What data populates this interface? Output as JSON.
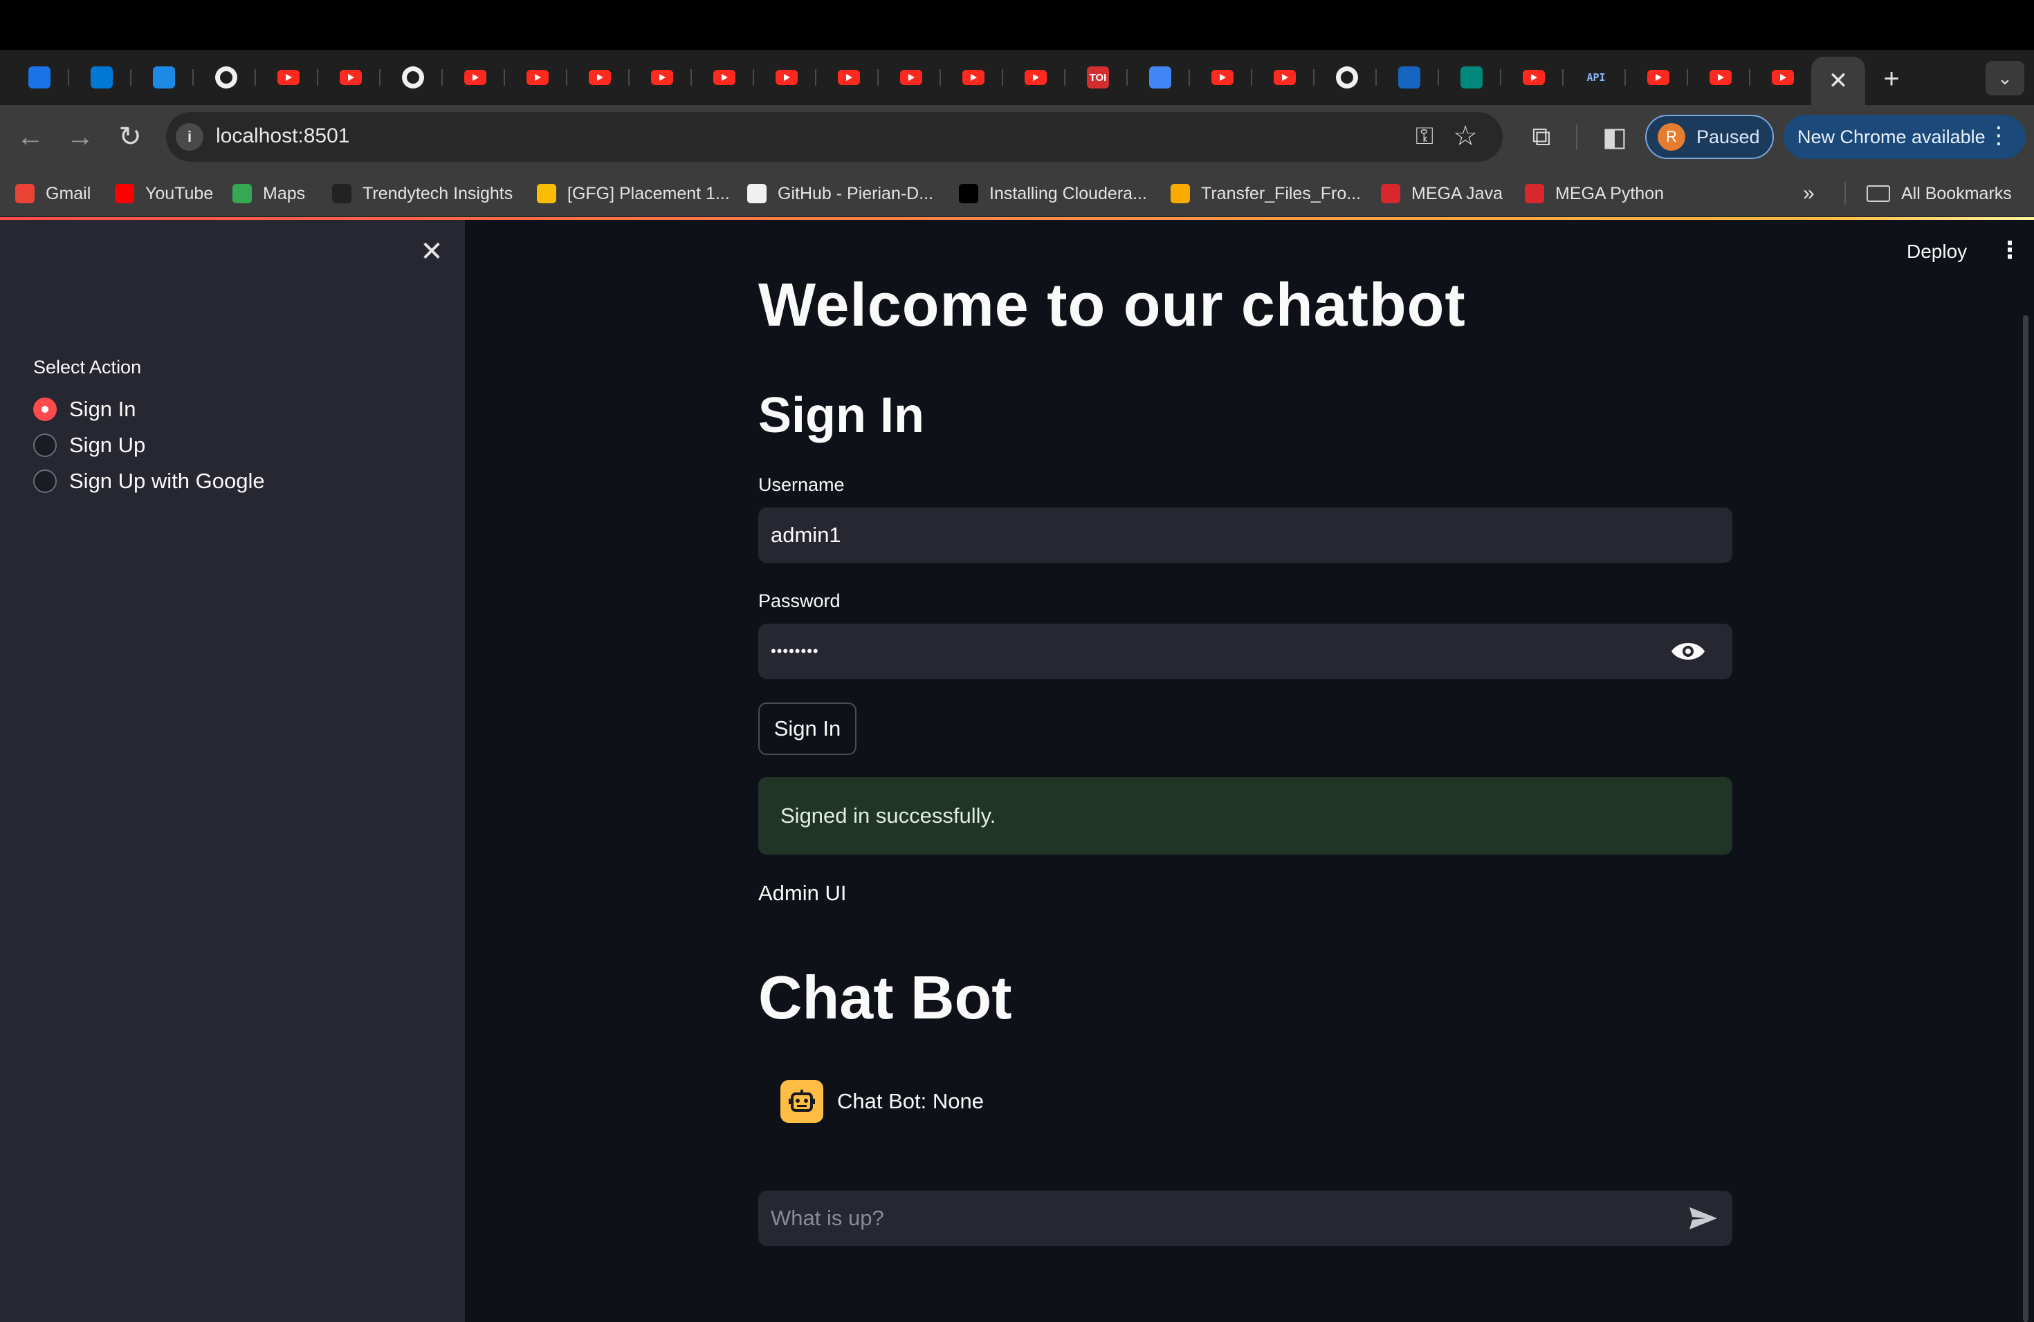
{
  "browser": {
    "tabs": [
      {
        "icon": "bar-chart-icon"
      },
      {
        "icon": "azure-devops-icon"
      },
      {
        "icon": "azure-icon"
      },
      {
        "icon": "github-icon"
      },
      {
        "icon": "youtube-icon"
      },
      {
        "icon": "youtube-icon"
      },
      {
        "icon": "github-icon"
      },
      {
        "icon": "youtube-icon"
      },
      {
        "icon": "youtube-icon"
      },
      {
        "icon": "youtube-icon"
      },
      {
        "icon": "youtube-icon"
      },
      {
        "icon": "youtube-icon"
      },
      {
        "icon": "youtube-icon"
      },
      {
        "icon": "youtube-icon"
      },
      {
        "icon": "youtube-icon"
      },
      {
        "icon": "youtube-icon"
      },
      {
        "icon": "youtube-icon"
      },
      {
        "icon": "toi-icon",
        "text": "TOI"
      },
      {
        "icon": "google-docs-icon"
      },
      {
        "icon": "youtube-icon"
      },
      {
        "icon": "youtube-icon"
      },
      {
        "icon": "github-icon"
      },
      {
        "icon": "chart-favicon-icon"
      },
      {
        "icon": "google-meet-icon"
      },
      {
        "icon": "youtube-icon"
      },
      {
        "icon": "api-icon",
        "text": "API"
      },
      {
        "icon": "youtube-icon"
      },
      {
        "icon": "youtube-icon"
      },
      {
        "icon": "youtube-icon"
      }
    ],
    "active_tab_close": "✕",
    "new_tab": "+",
    "url": "localhost:8501",
    "profile_initial": "R",
    "profile_status": "Paused",
    "update_label": "New Chrome available",
    "bookmarks": [
      {
        "label": "Gmail",
        "icon": "gmail-icon",
        "color": "#ea4335"
      },
      {
        "label": "YouTube",
        "icon": "youtube-icon",
        "color": "#ff0000"
      },
      {
        "label": "Maps",
        "icon": "maps-icon",
        "color": "#34a853"
      },
      {
        "label": "Trendytech Insights",
        "icon": "trendytech-icon",
        "color": "#222222"
      },
      {
        "label": "[GFG] Placement 1...",
        "icon": "google-drive-icon",
        "color": "#fbbc04"
      },
      {
        "label": "GitHub - Pierian-D...",
        "icon": "github-icon",
        "color": "#f0f0f0"
      },
      {
        "label": "Installing Cloudera...",
        "icon": "medium-icon",
        "color": "#000000"
      },
      {
        "label": "Transfer_Files_Fro...",
        "icon": "colab-icon",
        "color": "#f9ab00"
      },
      {
        "label": "MEGA Java",
        "icon": "mega-icon",
        "color": "#d9272e"
      },
      {
        "label": "MEGA Python",
        "icon": "mega-icon",
        "color": "#d9272e"
      }
    ],
    "all_bookmarks": "All Bookmarks"
  },
  "app": {
    "deploy_label": "Deploy",
    "sidebar": {
      "select_label": "Select Action",
      "options": [
        "Sign In",
        "Sign Up",
        "Sign Up with Google"
      ],
      "selected_index": 0
    },
    "title": "Welcome to our chatbot",
    "signin_heading": "Sign In",
    "username_label": "Username",
    "username_value": "admin1",
    "password_label": "Password",
    "password_value": "••••••••",
    "signin_button": "Sign In",
    "success_message": "Signed in successfully.",
    "admin_text": "Admin UI",
    "chat_heading": "Chat Bot",
    "bot_message": "Chat Bot: None",
    "chat_placeholder": "What is up?",
    "accent_color": "#ff4b4b"
  }
}
